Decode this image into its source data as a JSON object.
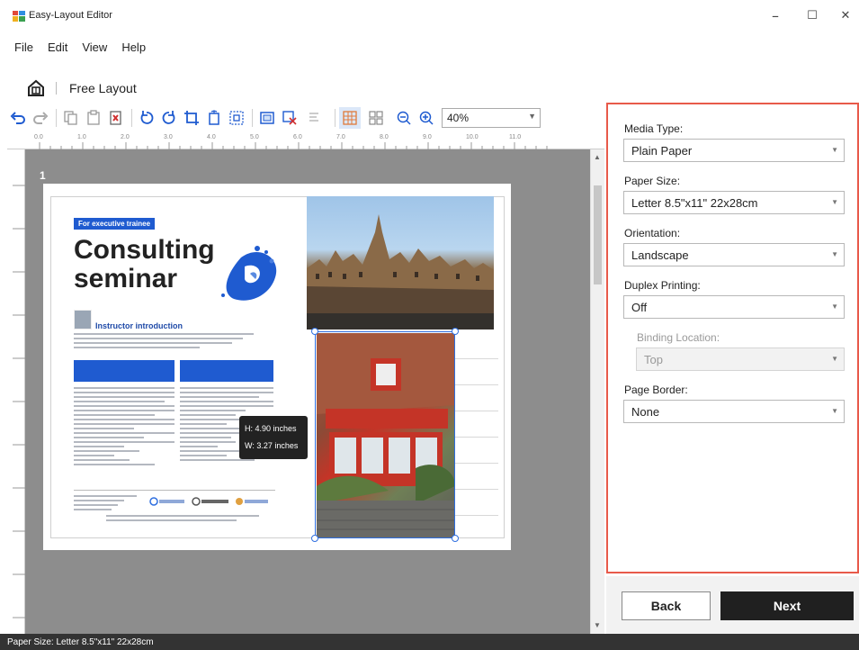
{
  "window": {
    "title": "Easy-Layout Editor",
    "minimize": "–",
    "maximize": "☐",
    "close": "✕"
  },
  "menu": [
    "File",
    "Edit",
    "View",
    "Help"
  ],
  "breadcrumb": {
    "title": "Free Layout"
  },
  "toolbar": {
    "zoom_value": "40%",
    "buttons": [
      "undo",
      "redo",
      "copy",
      "paste",
      "delete",
      "rotate-left",
      "rotate-right",
      "crop",
      "fit-page",
      "fit-frame",
      "frame",
      "image-settings",
      "align",
      "grid",
      "layout",
      "zoom-out",
      "zoom-in"
    ]
  },
  "ruler_labels": [
    "0.0",
    "1.0",
    "2.0",
    "3.0",
    "4.0",
    "5.0",
    "6.0",
    "7.0",
    "8.0",
    "9.0",
    "10.0",
    "11.0"
  ],
  "canvas": {
    "page_number": "1",
    "brochure": {
      "badge": "For executive trainee",
      "headline_line1": "Consulting",
      "headline_line2": "seminar",
      "intro_title": "Instructor introduction"
    },
    "tooltip": {
      "height": "H: 4.90 inches",
      "width": "W: 3.27 inches"
    }
  },
  "panel": {
    "media_type": {
      "label": "Media Type:",
      "value": "Plain Paper"
    },
    "paper_size": {
      "label": "Paper Size:",
      "value": "Letter 8.5\"x11\" 22x28cm"
    },
    "orientation": {
      "label": "Orientation:",
      "value": "Landscape"
    },
    "duplex": {
      "label": "Duplex Printing:",
      "value": "Off"
    },
    "binding": {
      "label": "Binding Location:",
      "value": "Top"
    },
    "page_border": {
      "label": "Page Border:",
      "value": "None"
    }
  },
  "buttons": {
    "back": "Back",
    "next": "Next"
  },
  "status": "Paper Size: Letter 8.5\"x11\" 22x28cm",
  "colors": {
    "accent": "#e85a4a",
    "selection": "#2f6fe0",
    "primary_button": "#202020",
    "canvas": "#8d8d8d"
  }
}
